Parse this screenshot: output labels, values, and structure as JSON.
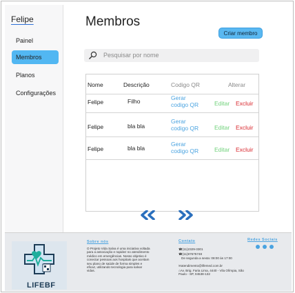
{
  "sidebar": {
    "user_name": "Felipe",
    "items": [
      {
        "label": "Painel"
      },
      {
        "label": "Membros",
        "active": true
      },
      {
        "label": "Planos"
      },
      {
        "label": "Configurações"
      }
    ]
  },
  "main": {
    "title": "Membros",
    "create_button": "Criar membro",
    "search_placeholder": "Pesquisar por nome"
  },
  "table": {
    "headers": [
      "Nome",
      "Descrição",
      "Codigo QR",
      "Alterar"
    ],
    "rows": [
      {
        "nome": "Felipe",
        "descricao": "Filho",
        "qr": "Gerar\ncodigo QR",
        "edit": "Editar",
        "delete": "Excluir"
      },
      {
        "nome": "Felipe",
        "descricao": "bla bla",
        "qr": "Gerar\ncodigo QR",
        "edit": "Editar",
        "delete": "Excluir"
      },
      {
        "nome": "Felipe",
        "descricao": "bla bla",
        "qr": "Gerar\ncodigo QR",
        "edit": "Editar",
        "delete": "Excluir"
      }
    ]
  },
  "pagination": {
    "prev_icon": "double-chevron-left-icon",
    "next_icon": "double-chevron-right-icon"
  },
  "footer": {
    "logo_text": "LIFEBF",
    "about_title": "Sobre nós",
    "about_text": "O Projeto Vida Salva é uma iniciativa voltada para a associação e rapidez no atendimento médico em emergências. Nosso objetivo é conectar pessoas aos hospitais que aceitam seu plano de saúde de forma simples e eficaz, utilizando tecnologia para salvar vidas.",
    "contact_title": "Contato",
    "contact_lines": [
      "(11)2329-3301",
      "(11)97675748",
      "De segunda a sexta: 08:00 às 17:00",
      "atendimento@lifemed.com.br",
      "Av. Brig. Faria Lima, 4440 - Vila Olímpia, São Paulo - SP, 04538-132"
    ],
    "social_title": "Redes Sociais"
  },
  "colors": {
    "accent": "#52b7f2",
    "edit": "#6fd17a",
    "delete": "#d9292f",
    "link": "#4aa3e0"
  }
}
